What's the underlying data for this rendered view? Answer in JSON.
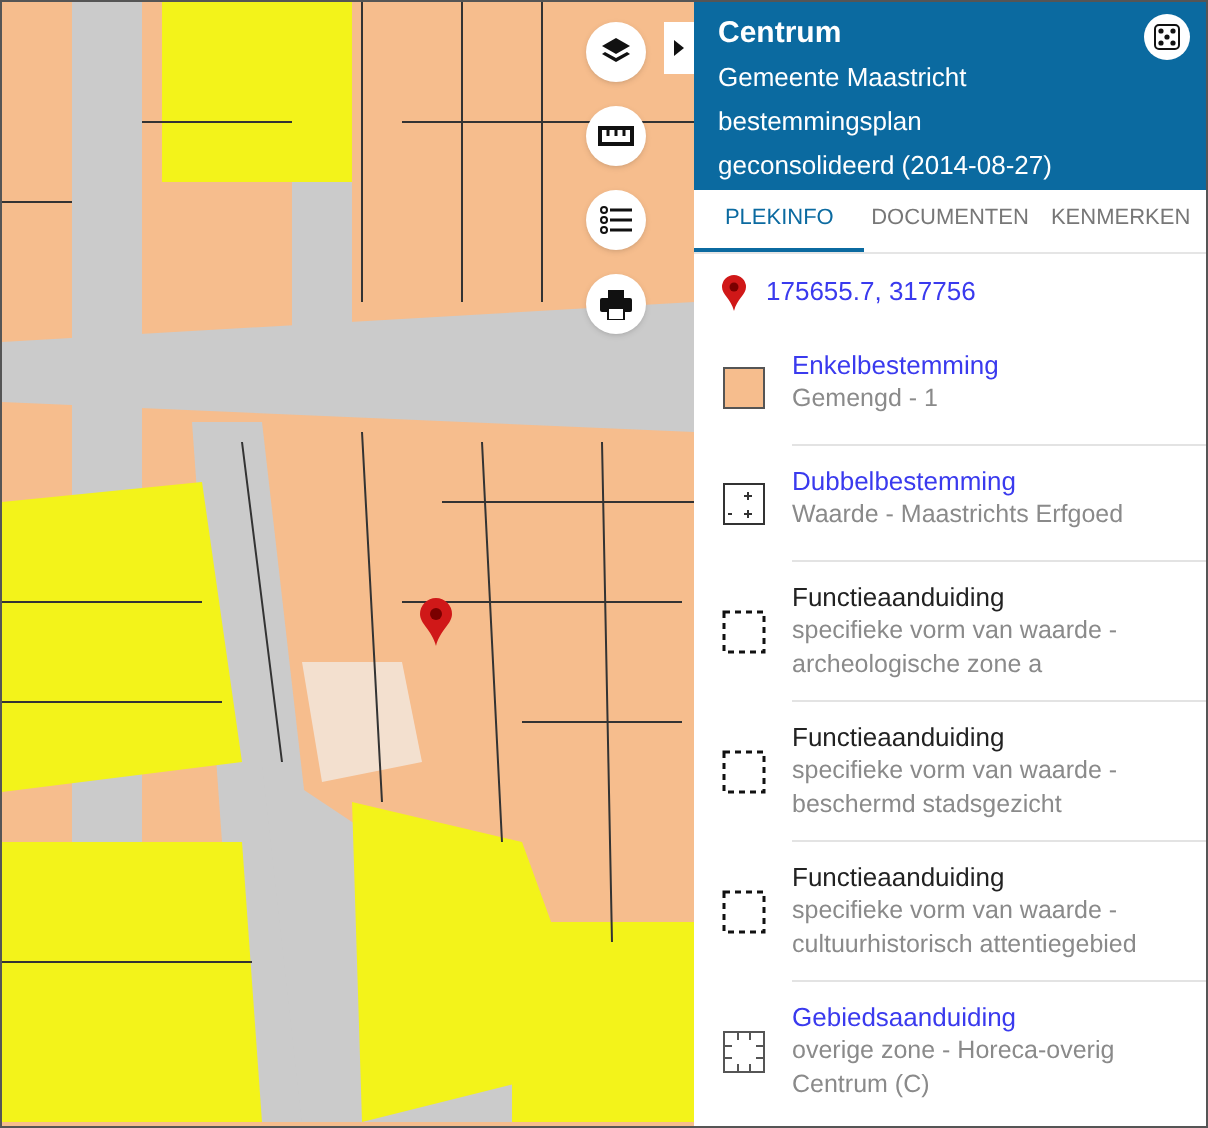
{
  "panel": {
    "title": "Centrum",
    "subtitle_lines": [
      "Gemeente Maastricht",
      "bestemmingsplan",
      "geconsolideerd (2014-08-27)"
    ]
  },
  "tabs": [
    {
      "label": "PLEKINFO",
      "selected": true
    },
    {
      "label": "DOCUMENTEN",
      "selected": false
    },
    {
      "label": "KENMERKEN",
      "selected": false
    }
  ],
  "location": {
    "coordinates": "175655.7, 317756"
  },
  "items": [
    {
      "kind": "fill",
      "title": "Enkelbestemming",
      "linked": true,
      "lines": [
        "Gemengd - 1"
      ]
    },
    {
      "kind": "plus",
      "title": "Dubbelbestemming",
      "linked": true,
      "lines": [
        "Waarde - Maastrichts Erfgoed"
      ]
    },
    {
      "kind": "dashed",
      "title": "Functieaanduiding",
      "linked": false,
      "lines": [
        "specifieke vorm van waarde -",
        "archeologische zone a"
      ]
    },
    {
      "kind": "dashed",
      "title": "Functieaanduiding",
      "linked": false,
      "lines": [
        "specifieke vorm van waarde -",
        "beschermd stadsgezicht"
      ]
    },
    {
      "kind": "dashed",
      "title": "Functieaanduiding",
      "linked": false,
      "lines": [
        "specifieke vorm van waarde -",
        "cultuurhistorisch attentiegebied"
      ]
    },
    {
      "kind": "corners",
      "title": "Gebiedsaanduiding",
      "linked": true,
      "lines": [
        "overige zone - Horeca-overig",
        "Centrum (C)"
      ]
    }
  ]
}
